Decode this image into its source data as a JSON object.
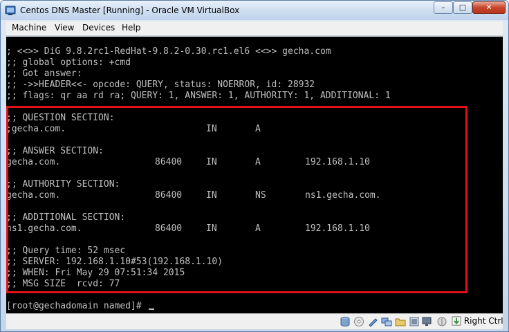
{
  "window": {
    "title": "Centos DNS Master [Running] - Oracle VM VirtualBox",
    "buttons": {
      "minimize_glyph": "–",
      "maximize_glyph": "□",
      "close_glyph": "✕"
    }
  },
  "menubar": {
    "items": [
      "Machine",
      "View",
      "Devices",
      "Help"
    ]
  },
  "console": {
    "header_lines": [
      "; <<>> DiG 9.8.2rc1-RedHat-9.8.2-0.30.rc1.el6 <<>> gecha.com",
      ";; global options: +cmd",
      ";; Got answer:",
      ";; ->>HEADER<<- opcode: QUERY, status: NOERROR, id: 28932",
      ";; flags: qr aa rd ra; QUERY: 1, ANSWER: 1, AUTHORITY: 1, ADDITIONAL: 1"
    ],
    "question_header": ";; QUESTION SECTION:",
    "question_row": {
      "name": ";gecha.com.",
      "class": "IN",
      "type": "A"
    },
    "answer_header": ";; ANSWER SECTION:",
    "answer_row": {
      "name": "gecha.com.",
      "ttl": "86400",
      "class": "IN",
      "type": "A",
      "data": "192.168.1.10"
    },
    "authority_header": ";; AUTHORITY SECTION:",
    "authority_row": {
      "name": "gecha.com.",
      "ttl": "86400",
      "class": "IN",
      "type": "NS",
      "data": "ns1.gecha.com."
    },
    "additional_header": ";; ADDITIONAL SECTION:",
    "additional_row": {
      "name": "ns1.gecha.com.",
      "ttl": "86400",
      "class": "IN",
      "type": "A",
      "data": "192.168.1.10"
    },
    "stats_lines": [
      ";; Query time: 52 msec",
      ";; SERVER: 192.168.1.10#53(192.168.1.10)",
      ";; WHEN: Fri May 29 07:51:34 2015",
      ";; MSG SIZE  rcvd: 77"
    ],
    "prompt": "[root@gechadomain named]# "
  },
  "statusbar": {
    "host_key": "Right Ctrl"
  },
  "colors": {
    "highlight": "#e1111a",
    "console_text": "#c0c0c0",
    "console_bg": "#000000"
  }
}
